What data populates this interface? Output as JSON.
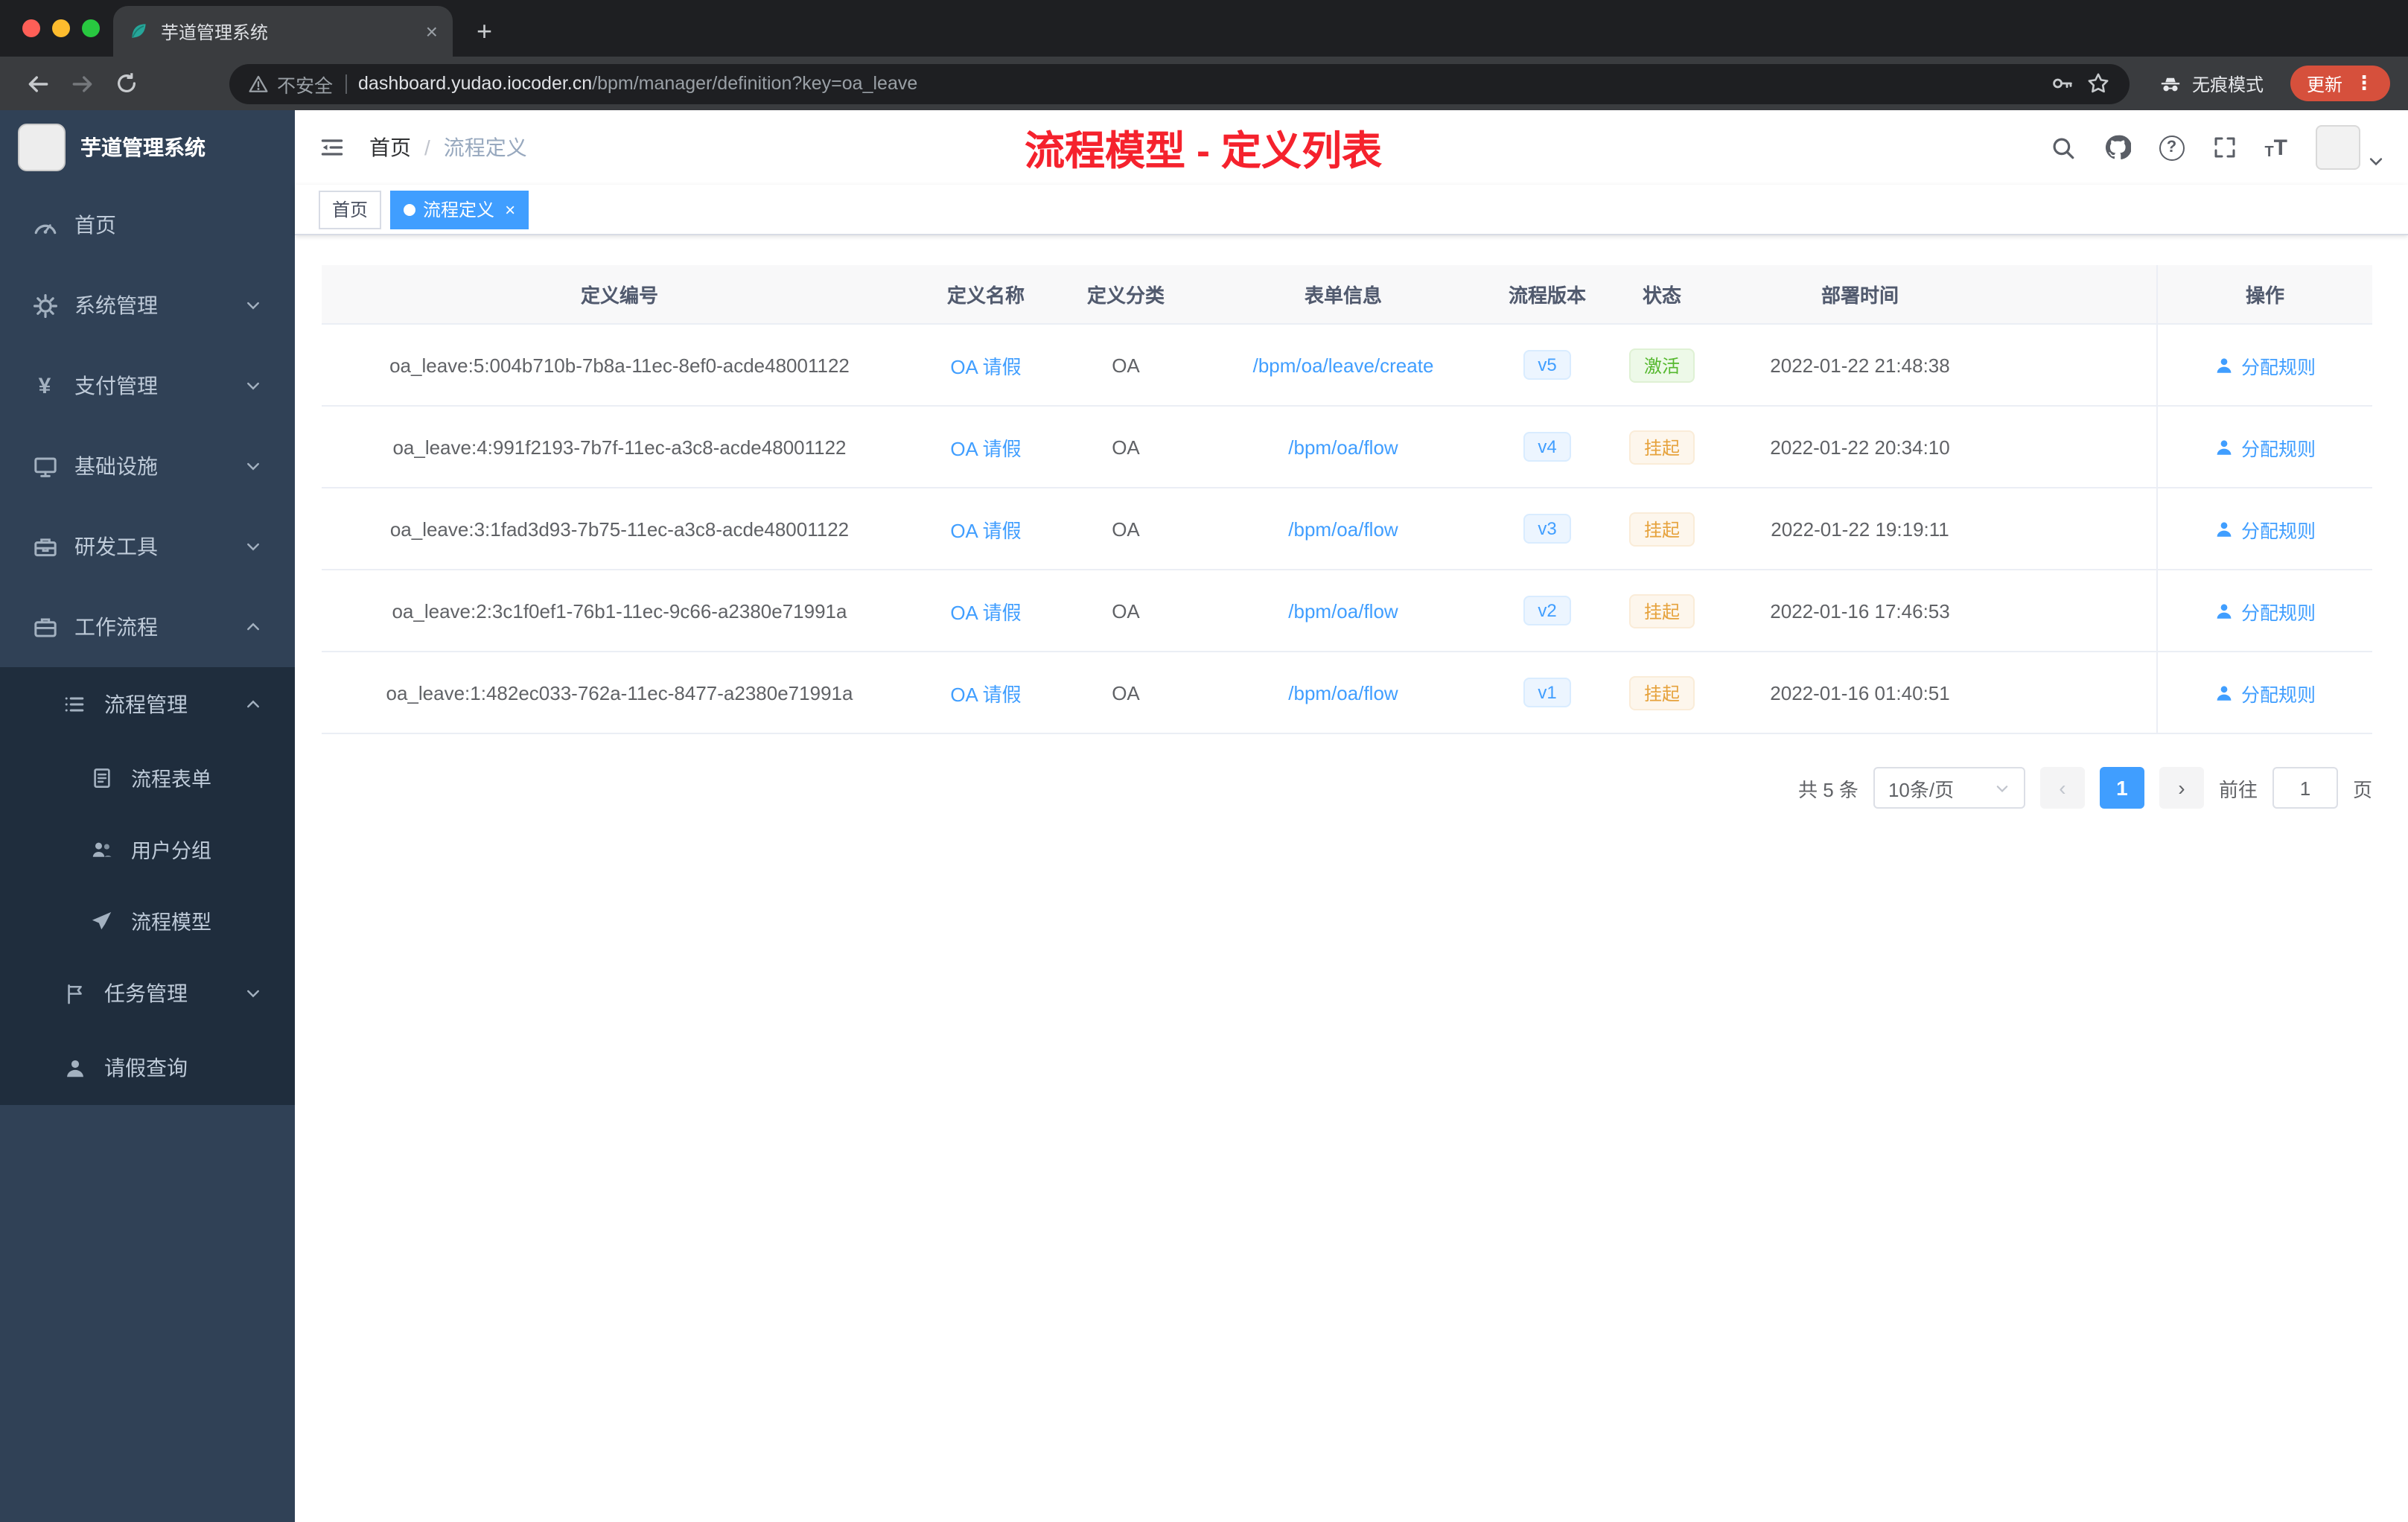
{
  "colors": {
    "accent": "#409eff",
    "page_title_red": "#f5222d",
    "status_success": "#67c23a",
    "status_warning": "#e6a23c",
    "sidebar_bg": "#304156",
    "submenu_bg": "#1f2d3d",
    "update_pill": "#d6503c"
  },
  "icons": {
    "close": "×",
    "plus": "+",
    "kebab": "⋮",
    "yen": "¥",
    "help": "?",
    "font_small": "T",
    "font_large": "T",
    "chevron_left": "‹",
    "chevron_right": "›"
  },
  "browser": {
    "tab_title": "芋道管理系统",
    "security_label": "不安全",
    "url_domain": "dashboard.yudao.iocoder.cn",
    "url_path": "/bpm/manager/definition?key=oa_leave",
    "incognito_label": "无痕模式",
    "update_label": "更新"
  },
  "sidebar": {
    "logo_title": "芋道管理系统",
    "items": [
      {
        "label": "首页"
      },
      {
        "label": "系统管理"
      },
      {
        "label": "支付管理"
      },
      {
        "label": "基础设施"
      },
      {
        "label": "研发工具"
      },
      {
        "label": "工作流程"
      }
    ],
    "sub": {
      "group1": "流程管理",
      "children": [
        {
          "label": "流程表单"
        },
        {
          "label": "用户分组"
        },
        {
          "label": "流程模型"
        }
      ],
      "group2": "任务管理",
      "leave": "请假查询"
    }
  },
  "navbar": {
    "breadcrumb_home": "首页",
    "breadcrumb_sep": "/",
    "breadcrumb_current": "流程定义",
    "page_title": "流程模型 - 定义列表"
  },
  "tags": {
    "home": "首页",
    "current": "流程定义"
  },
  "table": {
    "headers": [
      "定义编号",
      "定义名称",
      "定义分类",
      "表单信息",
      "流程版本",
      "状态",
      "部署时间",
      "操作"
    ],
    "rows": [
      {
        "id": "oa_leave:5:004b710b-7b8a-11ec-8ef0-acde48001122",
        "name": "OA 请假",
        "category": "OA",
        "form": "/bpm/oa/leave/create",
        "version": "v5",
        "status": "激活",
        "time": "2022-01-22 21:48:38",
        "action": "分配规则"
      },
      {
        "id": "oa_leave:4:991f2193-7b7f-11ec-a3c8-acde48001122",
        "name": "OA 请假",
        "category": "OA",
        "form": "/bpm/oa/flow",
        "version": "v4",
        "status": "挂起",
        "time": "2022-01-22 20:34:10",
        "action": "分配规则"
      },
      {
        "id": "oa_leave:3:1fad3d93-7b75-11ec-a3c8-acde48001122",
        "name": "OA 请假",
        "category": "OA",
        "form": "/bpm/oa/flow",
        "version": "v3",
        "status": "挂起",
        "time": "2022-01-22 19:19:11",
        "action": "分配规则"
      },
      {
        "id": "oa_leave:2:3c1f0ef1-76b1-11ec-9c66-a2380e71991a",
        "name": "OA 请假",
        "category": "OA",
        "form": "/bpm/oa/flow",
        "version": "v2",
        "status": "挂起",
        "time": "2022-01-16 17:46:53",
        "action": "分配规则"
      },
      {
        "id": "oa_leave:1:482ec033-762a-11ec-8477-a2380e71991a",
        "name": "OA 请假",
        "category": "OA",
        "form": "/bpm/oa/flow",
        "version": "v1",
        "status": "挂起",
        "time": "2022-01-16 01:40:51",
        "action": "分配规则"
      }
    ]
  },
  "pagination": {
    "total": "共 5 条",
    "page_size": "10条/页",
    "page": "1",
    "goto_label": "前往",
    "goto_value": "1",
    "goto_unit": "页"
  }
}
